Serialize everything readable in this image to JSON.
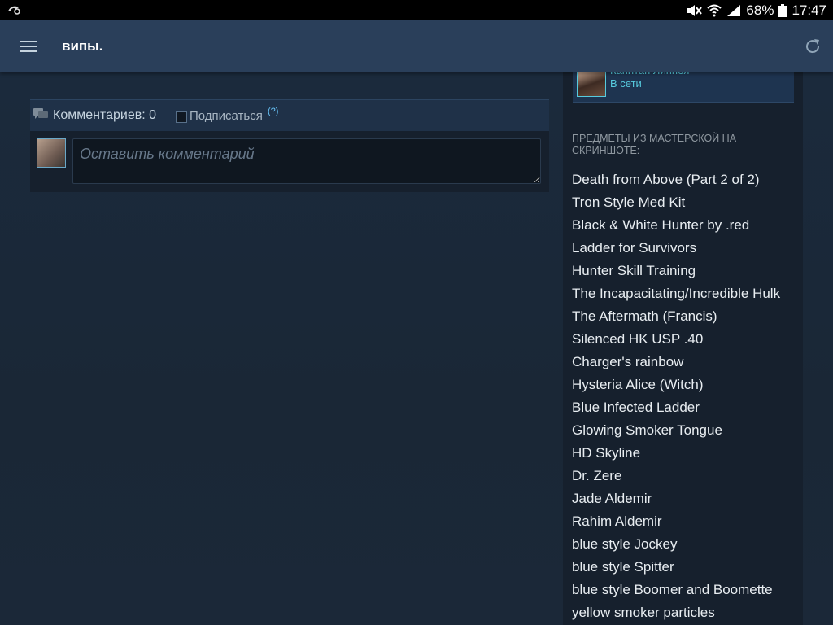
{
  "status_bar": {
    "battery": "68%",
    "time": "17:47"
  },
  "app_bar": {
    "title": "випы."
  },
  "comments": {
    "count_label": "Комментариев: 0",
    "subscribe_label": "Подписаться",
    "help_label": "(?)",
    "input_placeholder": "Оставить комментарий"
  },
  "sidebar": {
    "owner": {
      "name": "Капитан Линнея",
      "status": "В сети"
    },
    "items_title": "ПРЕДМЕТЫ ИЗ МАСТЕРСКОЙ НА СКРИНШОТЕ:",
    "items": [
      "Death from Above (Part 2 of 2)",
      "Tron Style Med Kit",
      "Black & White Hunter by .red",
      "Ladder for Survivors",
      "Hunter Skill Training",
      "The Incapacitating/Incredible Hulk",
      "The Aftermath (Francis)",
      "Silenced HK USP .40",
      "Charger's rainbow",
      "Hysteria Alice (Witch)",
      "Blue Infected Ladder",
      "Glowing Smoker Tongue",
      "HD Skyline",
      "Dr. Zere",
      "Jade Aldemir",
      "Rahim Aldemir",
      "blue style Jockey",
      "blue style Spitter",
      "blue style Boomer and Boomette",
      "yellow smoker particles"
    ]
  }
}
